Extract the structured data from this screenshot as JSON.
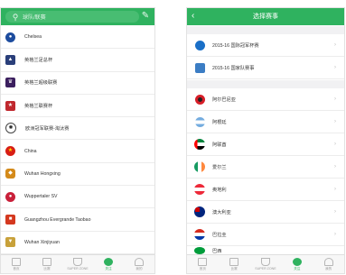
{
  "left_phone": {
    "search_placeholder": "球队/联赛",
    "teams": [
      {
        "name": "Chelsea",
        "icon": "chelsea-logo-icon",
        "color": "#1d4c9e"
      },
      {
        "name": "英格兰足总杯",
        "icon": "fa-cup-logo-icon",
        "color": "#2a3f7a"
      },
      {
        "name": "英格兰超级联赛",
        "icon": "premier-league-logo-icon",
        "color": "#3b1f5e"
      },
      {
        "name": "英格兰联赛杯",
        "icon": "league-cup-logo-icon",
        "color": "#c0282e"
      },
      {
        "name": "欧洲冠军联赛-淘汰赛",
        "icon": "champions-league-logo-icon",
        "color": "#222222"
      },
      {
        "name": "China",
        "icon": "china-flag-icon",
        "color": "#d81e14"
      },
      {
        "name": "Wuhan Hongxing",
        "icon": "wuhan-hongxing-logo-icon",
        "color": "#d48a1a"
      },
      {
        "name": "Wuppertaler SV",
        "icon": "wuppertaler-logo-icon",
        "color": "#c9203a"
      },
      {
        "name": "Guangzhou Evergrande Taobao",
        "icon": "guangzhou-evergrande-logo-icon",
        "color": "#d4381f"
      },
      {
        "name": "Wuhan Xinjiyuan",
        "icon": "wuhan-xinjiyuan-logo-icon",
        "color": "#c8a13a"
      }
    ],
    "tabs": [
      {
        "label": "首页",
        "active": false
      },
      {
        "label": "比赛",
        "active": false
      },
      {
        "label": "SUPER ZONE",
        "active": false
      },
      {
        "label": "关注",
        "active": true
      },
      {
        "label": "我的",
        "active": false
      }
    ]
  },
  "right_phone": {
    "title": "选择赛事",
    "competitions": [
      {
        "name": "2015-16 国际冠军杯赛",
        "icon": "icc-logo-icon"
      },
      {
        "name": "2015-16 国家队赛事",
        "icon": "national-team-logo-icon"
      }
    ],
    "countries": [
      {
        "name": "阿尔巴尼亚",
        "icon": "albania-flag-icon",
        "colors": [
          "#d71e28",
          "#222222"
        ]
      },
      {
        "name": "阿根廷",
        "icon": "argentina-flag-icon",
        "colors": [
          "#74acdf",
          "#ffffff"
        ]
      },
      {
        "name": "阿联酋",
        "icon": "uae-flag-icon",
        "colors": [
          "#00843d",
          "#ffffff",
          "#000000",
          "#ff0000"
        ]
      },
      {
        "name": "爱尔兰",
        "icon": "ireland-flag-icon",
        "colors": [
          "#169b62",
          "#ffffff",
          "#ff883e"
        ]
      },
      {
        "name": "奥地利",
        "icon": "austria-flag-icon",
        "colors": [
          "#ed2939",
          "#ffffff"
        ]
      },
      {
        "name": "澳大利亚",
        "icon": "australia-flag-icon",
        "colors": [
          "#00247d",
          "#cc0000"
        ]
      },
      {
        "name": "巴拉圭",
        "icon": "paraguay-flag-icon",
        "colors": [
          "#d52b1e",
          "#ffffff",
          "#0038a8"
        ]
      },
      {
        "name": "巴西",
        "icon": "brazil-flag-icon",
        "colors": [
          "#009c3b",
          "#ffdf00"
        ]
      }
    ],
    "tabs": [
      {
        "label": "首页",
        "active": false
      },
      {
        "label": "比赛",
        "active": false
      },
      {
        "label": "SUPER ZONE",
        "active": false
      },
      {
        "label": "关注",
        "active": true
      },
      {
        "label": "我的",
        "active": false
      }
    ]
  },
  "colors": {
    "brand_green": "#2fb25f"
  }
}
